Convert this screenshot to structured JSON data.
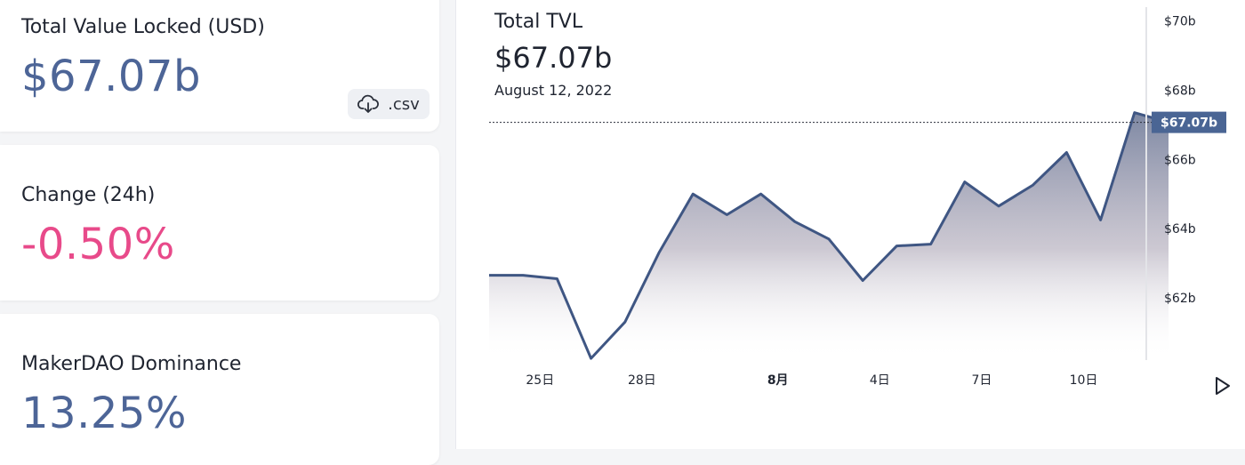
{
  "cards": {
    "tvl": {
      "label": "Total Value Locked (USD)",
      "value": "$67.07b",
      "csv_label": ".csv"
    },
    "change": {
      "label": "Change (24h)",
      "value": "-0.50%"
    },
    "dominance": {
      "label": "MakerDAO Dominance",
      "value": "13.25%"
    }
  },
  "chart_panel": {
    "title": "Total TVL",
    "value": "$67.07b",
    "date": "August 12, 2022",
    "current_label": "$67.07b",
    "current_value": 67.07
  },
  "colors": {
    "accent": "#4d6597",
    "negative": "#e84a8a",
    "line": "#3f5683",
    "crosshair_badge": "#4a6594"
  },
  "icons": {
    "download": "download-icon",
    "play": "play-icon"
  },
  "chart_data": {
    "type": "area",
    "series": [
      {
        "values": [
          62.65,
          62.65,
          62.55,
          60.25,
          61.3,
          63.3,
          65.0,
          64.4,
          65.0,
          64.2,
          63.7,
          62.5,
          63.5,
          63.55,
          65.35,
          64.65,
          65.25,
          66.2,
          64.25,
          67.35,
          67.07
        ]
      }
    ],
    "xticks": [
      {
        "label": "25日",
        "index": 1.5,
        "bold": false
      },
      {
        "label": "28日",
        "index": 4.5,
        "bold": false
      },
      {
        "label": "8月",
        "index": 8.5,
        "bold": true
      },
      {
        "label": "4日",
        "index": 11.5,
        "bold": false
      },
      {
        "label": "7日",
        "index": 14.5,
        "bold": false
      },
      {
        "label": "10日",
        "index": 17.5,
        "bold": false
      }
    ],
    "yticks": [
      {
        "label": "$62b",
        "value": 62
      },
      {
        "label": "$64b",
        "value": 64
      },
      {
        "label": "$66b",
        "value": 66
      },
      {
        "label": "$68b",
        "value": 68
      },
      {
        "label": "$70b",
        "value": 70
      }
    ],
    "ylim": [
      60.2,
      70.4
    ],
    "grid": false
  }
}
